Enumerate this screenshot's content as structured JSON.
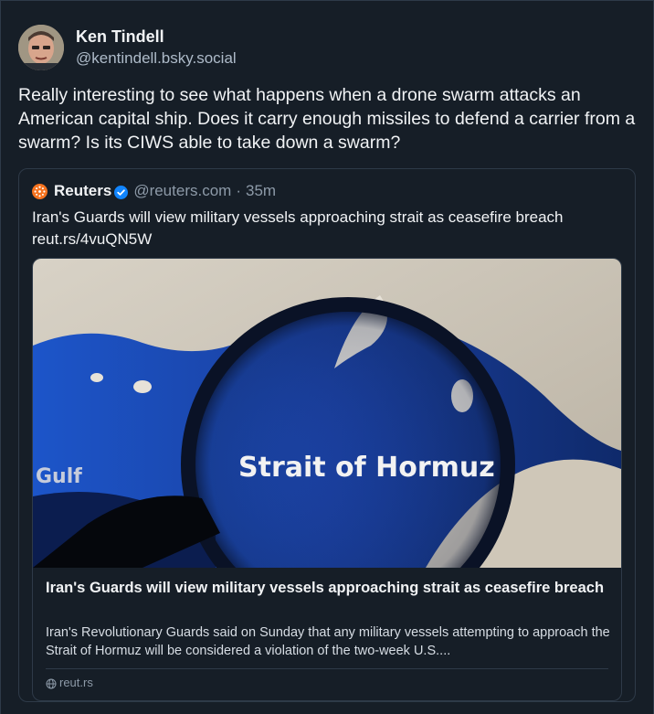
{
  "post": {
    "author": {
      "display_name": "Ken Tindell",
      "handle": "@kentindell.bsky.social"
    },
    "text": "Really interesting to see what happens when a drone swarm attacks an American capital ship. Does it carry enough missiles to defend a carrier from a swarm? Is its CIWS able to take down a swarm?",
    "quote": {
      "author_name": "Reuters",
      "handle": "@reuters.com",
      "separator": "·",
      "time": "35m",
      "text": "Iran's Guards will view military vessels approaching strait as ceasefire breach reut.rs/4vuQN5W",
      "link_card": {
        "image_label_main": "Strait of Hormuz",
        "image_label_gulf": "Gulf",
        "title": "Iran's Guards will view military vessels approaching strait as ceasefire breach",
        "description": "Iran's Revolutionary Guards said on Sunday that any military vessels attempting to approach the Strait of Hormuz will be considered a violation of the two-week U.S....",
        "domain": "reut.rs"
      }
    }
  },
  "colors": {
    "background": "#161e27",
    "border": "#2e3a48",
    "verified_blue": "#1185fe",
    "reuters_orange": "#f5731f"
  },
  "icons": {
    "verified": "verified-badge-icon",
    "reuters": "reuters-logo-icon",
    "globe": "globe-icon"
  }
}
